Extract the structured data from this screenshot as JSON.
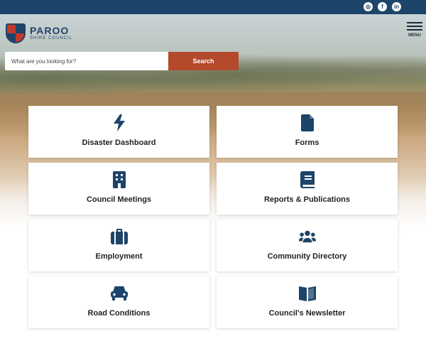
{
  "colors": {
    "topbar": "#1d4469",
    "accent": "#b4492b",
    "icon": "#1d4469"
  },
  "social": [
    {
      "icon": "instagram-icon",
      "glyph": "◎"
    },
    {
      "icon": "facebook-icon",
      "glyph": "f"
    },
    {
      "icon": "linkedin-icon",
      "glyph": "in"
    }
  ],
  "logo": {
    "name": "PAROO",
    "sub": "SHIRE COUNCIL"
  },
  "menu": {
    "label": "MENU"
  },
  "search": {
    "placeholder": "What are you looking for?",
    "button_label": "Search"
  },
  "cards": [
    {
      "label": "Disaster Dashboard",
      "icon": "lightning-icon"
    },
    {
      "label": "Forms",
      "icon": "file-icon"
    },
    {
      "label": "Council Meetings",
      "icon": "building-icon"
    },
    {
      "label": "Reports & Publications",
      "icon": "book-icon"
    },
    {
      "label": "Employment",
      "icon": "briefcase-icon"
    },
    {
      "label": "Community Directory",
      "icon": "users-icon"
    },
    {
      "label": "Road Conditions",
      "icon": "car-icon"
    },
    {
      "label": "Council's Newsletter",
      "icon": "open-book-icon"
    }
  ]
}
